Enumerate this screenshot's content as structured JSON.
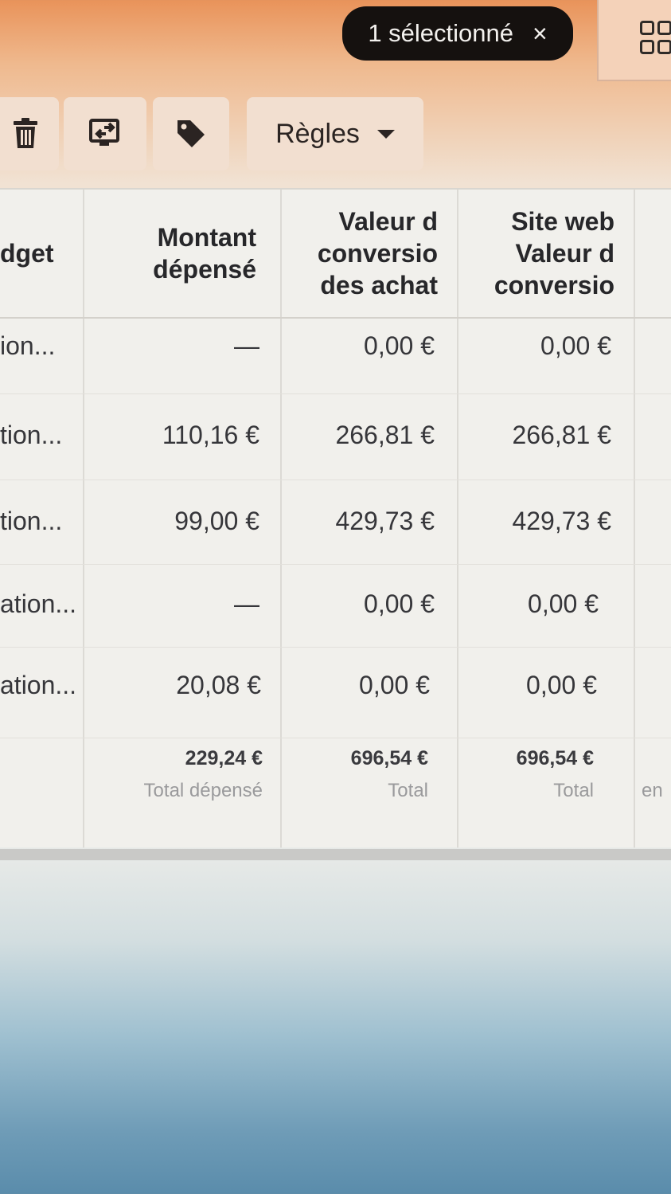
{
  "selection": {
    "label": "1 sélectionné",
    "close_icon": "×"
  },
  "toolbar": {
    "rules_label": "Règles"
  },
  "icons": [
    "trash-icon",
    "share-icon",
    "tag-icon",
    "caret-down-icon",
    "grid-view-icon"
  ],
  "columns": {
    "budget": "dget",
    "spent": [
      "Montant",
      "dépensé"
    ],
    "purchase_value": [
      "Valeur d",
      "conversio",
      "des achat"
    ],
    "web_value": [
      "Site web",
      "Valeur d",
      "conversio"
    ]
  },
  "rows": [
    {
      "name": "ion...",
      "spent": "—",
      "purchase_value": "0,00 €",
      "web_value": "0,00 €"
    },
    {
      "name": "tion...",
      "spent": "110,16 €",
      "purchase_value": "266,81 €",
      "web_value": "266,81 €"
    },
    {
      "name": "tion...",
      "spent": "99,00 €",
      "purchase_value": "429,73 €",
      "web_value": "429,73 €"
    },
    {
      "name": "ation...",
      "spent": "—",
      "purchase_value": "0,00 €",
      "web_value": "0,00 €"
    },
    {
      "name": "ation...",
      "spent": "20,08 €",
      "purchase_value": "0,00 €",
      "web_value": "0,00 €"
    }
  ],
  "totals": {
    "spent": {
      "value": "229,24 €",
      "label": "Total dépensé"
    },
    "purchase_value": {
      "value": "696,54 €",
      "label": "Total"
    },
    "web_value": {
      "value": "696,54 €",
      "label": "Total"
    },
    "extra": "en"
  }
}
